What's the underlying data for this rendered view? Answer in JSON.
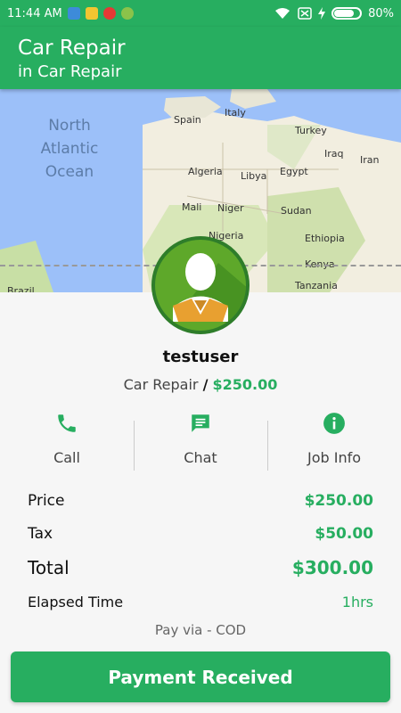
{
  "status_bar": {
    "time": "11:44 AM",
    "battery_percent": "80%",
    "battery_level": 0.8,
    "icons": [
      "usb-icon",
      "app-icon",
      "chrome-icon",
      "android-icon",
      "wifi-icon",
      "sim-icon",
      "charging-icon",
      "battery-icon"
    ]
  },
  "header": {
    "title": "Car Repair",
    "subtitle": "in Car Repair"
  },
  "map": {
    "ocean_label": [
      "North",
      "Atlantic",
      "Ocean"
    ],
    "countries": [
      "Spain",
      "Italy",
      "Turkey",
      "Iraq",
      "Iran",
      "Algeria",
      "Libya",
      "Egypt",
      "Mali",
      "Niger",
      "Sudan",
      "Nigeria",
      "Ethiopia",
      "Kenya",
      "Tanzania",
      "Brazil"
    ]
  },
  "profile": {
    "username": "testuser",
    "service": "Car Repair",
    "separator": "/",
    "amount": "$250.00"
  },
  "actions": [
    {
      "label": "Call",
      "icon": "phone-icon"
    },
    {
      "label": "Chat",
      "icon": "chat-icon"
    },
    {
      "label": "Job Info",
      "icon": "info-icon"
    }
  ],
  "summary": {
    "price_label": "Price",
    "price_value": "$250.00",
    "tax_label": "Tax",
    "tax_value": "$50.00",
    "total_label": "Total",
    "total_value": "$300.00",
    "elapsed_label": "Elapsed Time",
    "elapsed_value": "1hrs"
  },
  "payment": {
    "method": "Pay via - COD",
    "button_label": "Payment Received"
  },
  "colors": {
    "primary": "#27ae60",
    "map_water": "#9cc0f9",
    "map_land": "#f2eee0"
  }
}
